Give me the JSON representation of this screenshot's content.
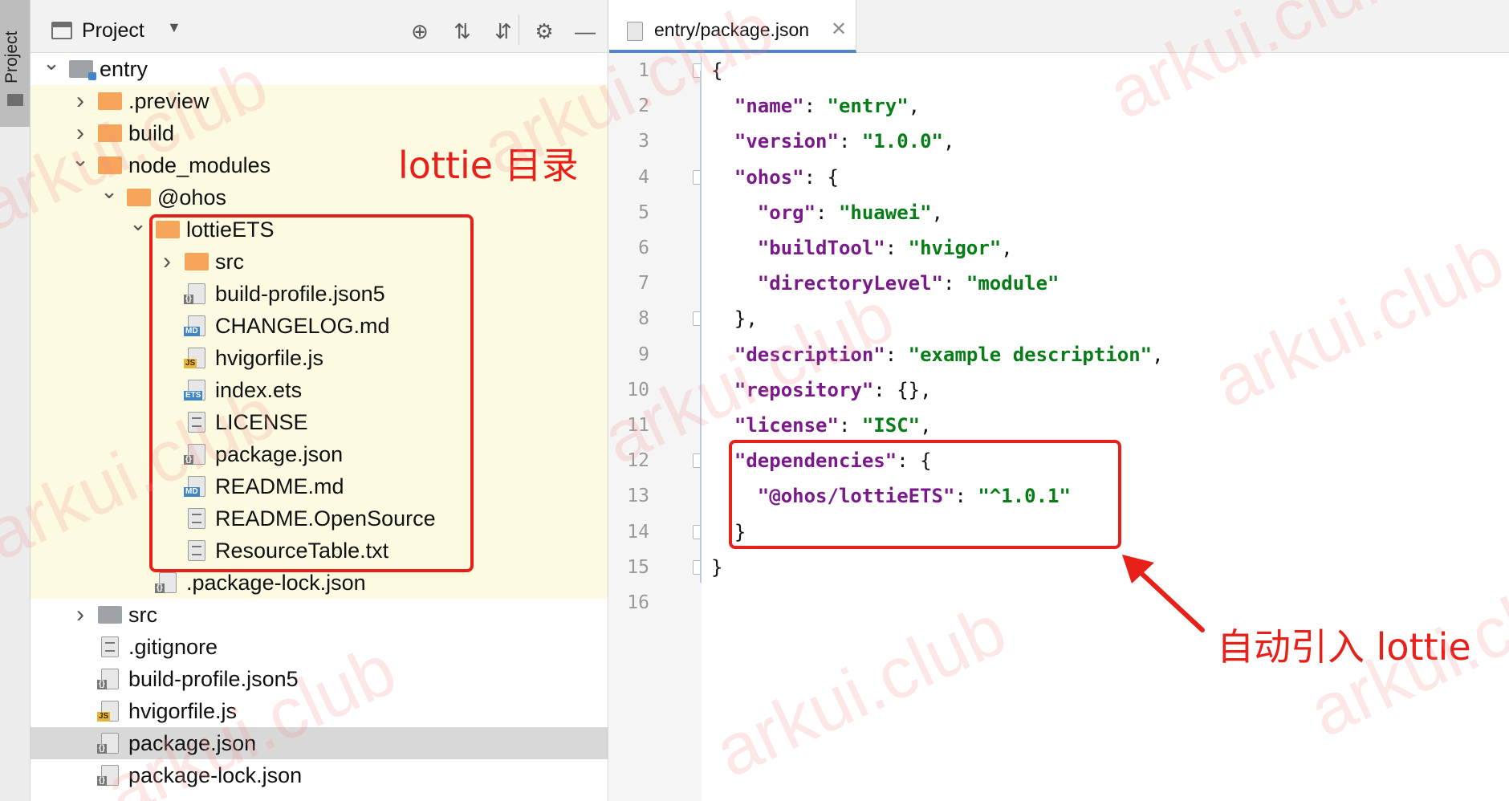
{
  "stripe": {
    "label": "Project"
  },
  "project_panel": {
    "title": "Project",
    "dropdown": "▼",
    "tools": {
      "locate": "⊕",
      "expand": "⇅",
      "collapse": "⇵",
      "settings": "⚙",
      "hide": "—"
    }
  },
  "tree": [
    {
      "label": "entry",
      "indent": 0,
      "expanded": true,
      "kind": "module",
      "hl": false
    },
    {
      "label": ".preview",
      "indent": 1,
      "expanded": false,
      "kind": "folder",
      "hl": true
    },
    {
      "label": "build",
      "indent": 1,
      "expanded": false,
      "kind": "folder",
      "hl": true
    },
    {
      "label": "node_modules",
      "indent": 1,
      "expanded": true,
      "kind": "folder",
      "hl": true
    },
    {
      "label": "@ohos",
      "indent": 2,
      "expanded": true,
      "kind": "folder",
      "hl": true
    },
    {
      "label": "lottieETS",
      "indent": 3,
      "expanded": true,
      "kind": "folder",
      "hl": true
    },
    {
      "label": "src",
      "indent": 4,
      "expanded": false,
      "kind": "folder",
      "hl": true
    },
    {
      "label": "build-profile.json5",
      "indent": 4,
      "kind": "json",
      "hl": true
    },
    {
      "label": "CHANGELOG.md",
      "indent": 4,
      "kind": "md",
      "hl": true
    },
    {
      "label": "hvigorfile.js",
      "indent": 4,
      "kind": "js",
      "hl": true
    },
    {
      "label": "index.ets",
      "indent": 4,
      "kind": "ets",
      "hl": true
    },
    {
      "label": "LICENSE",
      "indent": 4,
      "kind": "text",
      "hl": true
    },
    {
      "label": "package.json",
      "indent": 4,
      "kind": "json",
      "hl": true
    },
    {
      "label": "README.md",
      "indent": 4,
      "kind": "md",
      "hl": true
    },
    {
      "label": "README.OpenSource",
      "indent": 4,
      "kind": "text",
      "hl": true
    },
    {
      "label": "ResourceTable.txt",
      "indent": 4,
      "kind": "text",
      "hl": true
    },
    {
      "label": ".package-lock.json",
      "indent": 3,
      "kind": "json",
      "hl": true
    },
    {
      "label": "src",
      "indent": 1,
      "expanded": false,
      "kind": "folder-grey",
      "hl": false
    },
    {
      "label": ".gitignore",
      "indent": 1,
      "kind": "ignore",
      "hl": false
    },
    {
      "label": "build-profile.json5",
      "indent": 1,
      "kind": "json",
      "hl": false
    },
    {
      "label": "hvigorfile.js",
      "indent": 1,
      "kind": "js",
      "hl": false
    },
    {
      "label": "package.json",
      "indent": 1,
      "kind": "json",
      "hl": false,
      "selected": true
    },
    {
      "label": "package-lock.json",
      "indent": 1,
      "kind": "json",
      "hl": false
    }
  ],
  "editor": {
    "tab_label": "entry/package.json",
    "tab_close": "✕",
    "line_numbers": [
      "1",
      "2",
      "3",
      "4",
      "5",
      "6",
      "7",
      "8",
      "9",
      "10",
      "11",
      "12",
      "13",
      "14",
      "15",
      "16"
    ],
    "lines": [
      [
        [
          "pun",
          "{"
        ]
      ],
      [
        [
          "pun",
          "  "
        ],
        [
          "key",
          "\"name\""
        ],
        [
          "pun",
          ": "
        ],
        [
          "str",
          "\"entry\""
        ],
        [
          "pun",
          ","
        ]
      ],
      [
        [
          "pun",
          "  "
        ],
        [
          "key",
          "\"version\""
        ],
        [
          "pun",
          ": "
        ],
        [
          "str",
          "\"1.0.0\""
        ],
        [
          "pun",
          ","
        ]
      ],
      [
        [
          "pun",
          "  "
        ],
        [
          "key",
          "\"ohos\""
        ],
        [
          "pun",
          ": {"
        ]
      ],
      [
        [
          "pun",
          "    "
        ],
        [
          "key",
          "\"org\""
        ],
        [
          "pun",
          ": "
        ],
        [
          "str",
          "\"huawei\""
        ],
        [
          "pun",
          ","
        ]
      ],
      [
        [
          "pun",
          "    "
        ],
        [
          "key",
          "\"buildTool\""
        ],
        [
          "pun",
          ": "
        ],
        [
          "str",
          "\"hvigor\""
        ],
        [
          "pun",
          ","
        ]
      ],
      [
        [
          "pun",
          "    "
        ],
        [
          "key",
          "\"directoryLevel\""
        ],
        [
          "pun",
          ": "
        ],
        [
          "str",
          "\"module\""
        ]
      ],
      [
        [
          "pun",
          "  },"
        ]
      ],
      [
        [
          "pun",
          "  "
        ],
        [
          "key",
          "\"description\""
        ],
        [
          "pun",
          ": "
        ],
        [
          "str",
          "\"example description\""
        ],
        [
          "pun",
          ","
        ]
      ],
      [
        [
          "pun",
          "  "
        ],
        [
          "key",
          "\"repository\""
        ],
        [
          "pun",
          ": {},"
        ]
      ],
      [
        [
          "pun",
          "  "
        ],
        [
          "key",
          "\"license\""
        ],
        [
          "pun",
          ": "
        ],
        [
          "str",
          "\"ISC\""
        ],
        [
          "pun",
          ","
        ]
      ],
      [
        [
          "pun",
          "  "
        ],
        [
          "key",
          "\"dependencies\""
        ],
        [
          "pun",
          ": {"
        ]
      ],
      [
        [
          "pun",
          "    "
        ],
        [
          "key",
          "\"@ohos/lottieETS\""
        ],
        [
          "pun",
          ": "
        ],
        [
          "str",
          "\"^1.0.1\""
        ]
      ],
      [
        [
          "pun",
          "  }"
        ]
      ],
      [
        [
          "pun",
          "}"
        ]
      ],
      []
    ]
  },
  "annotations": {
    "lottie_dir": "lottie 目录",
    "auto_import": "自动引入 lottie",
    "watermark": "arkui.club"
  },
  "colors": {
    "annotation_red": "#e8201a",
    "json_key": "#7a1a8a",
    "json_string": "#067d17",
    "folder": "#f6a55a",
    "highlight": "#fcfbe2"
  }
}
